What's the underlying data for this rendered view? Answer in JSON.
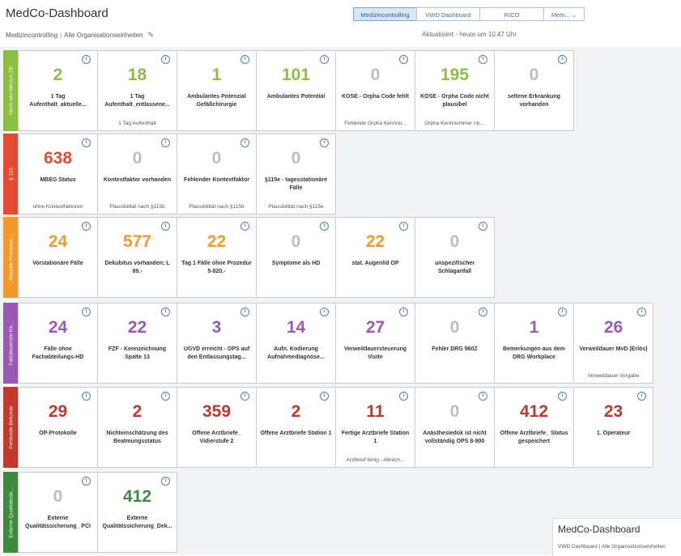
{
  "app": {
    "title": "MedCo-Dashboard",
    "breadcrumb_1": "Medizincontrolling",
    "breadcrumb_sep": "|",
    "breadcrumb_2": "Alle Organisationseinheiten",
    "updated": "Aktualisiert - heute um 10:47 Uhr"
  },
  "tabs": [
    {
      "label": "Medizincontrolling",
      "active": true
    },
    {
      "label": "VWD Dashboard",
      "active": false
    },
    {
      "label": "RICO",
      "active": false
    },
    {
      "label": "Mehr...",
      "active": false
    }
  ],
  "colors": {
    "green": "#8cbf3f",
    "red": "#e74b2f",
    "orange": "#f39a2b",
    "purple": "#9b59b6",
    "crimson": "#c0392b",
    "darkgreen": "#3d8a3d",
    "zero": "#b8bec6"
  },
  "rows": [
    {
      "band_label": "Hoch wie hierzus ZB",
      "band_color": "#8cbf3f",
      "tiles": [
        {
          "value": "2",
          "color": "#8cbf3f",
          "label": "1 Tag Aufenthalt_aktuelle...",
          "sub": ""
        },
        {
          "value": "18",
          "color": "#8cbf3f",
          "label": "1 Tag Aufenthalt_entlassene...",
          "sub": "1 Tag Aufenthalt"
        },
        {
          "value": "1",
          "color": "#8cbf3f",
          "label": "Ambulantes Potenzial Gefäßchirurgie",
          "sub": ""
        },
        {
          "value": "101",
          "color": "#8cbf3f",
          "label": "Ambulantes Potential",
          "sub": ""
        },
        {
          "value": "0",
          "color": "#b8bec6",
          "label": "KOSE - Orpha Code fehlt",
          "sub": "Fehlende Orpha Kennnu..."
        },
        {
          "value": "195",
          "color": "#8cbf3f",
          "label": "KOSE - Orpha Code nicht plausibel",
          "sub": "Orpha Kennnummer nic..."
        },
        {
          "value": "0",
          "color": "#b8bec6",
          "label": "seltene Erkrankung vorhanden",
          "sub": ""
        }
      ]
    },
    {
      "band_label": "§ 115",
      "band_color": "#e74b2f",
      "tiles": [
        {
          "value": "638",
          "color": "#e74b2f",
          "label": "MBEG Status",
          "sub": "ohne Kontextfaktoren"
        },
        {
          "value": "0",
          "color": "#b8bec6",
          "label": "Kontextfaktor vorhanden",
          "sub": "Plausibilität nach §115b"
        },
        {
          "value": "0",
          "color": "#b8bec6",
          "label": "Fehlender Kontextfaktor",
          "sub": "Plausibilität nach §115b"
        },
        {
          "value": "0",
          "color": "#b8bec6",
          "label": "§115e - tagesstationäre Fälle",
          "sub": "Plausibilität nach §115e"
        }
      ]
    },
    {
      "band_label": "Aktuelle Prozesse...",
      "band_color": "#f39a2b",
      "tiles": [
        {
          "value": "24",
          "color": "#f39a2b",
          "label": "Vorstationäre Fälle",
          "sub": ""
        },
        {
          "value": "577",
          "color": "#f39a2b",
          "label": "Dekubitus vorhanden; L 89.-",
          "sub": ""
        },
        {
          "value": "22",
          "color": "#f39a2b",
          "label": "Tag 1 Fälle ohne Prozedur 5-820.-",
          "sub": ""
        },
        {
          "value": "0",
          "color": "#b8bec6",
          "label": "Symptome als HD",
          "sub": ""
        },
        {
          "value": "22",
          "color": "#f39a2b",
          "label": "stat. Augenlid OP",
          "sub": ""
        },
        {
          "value": "0",
          "color": "#b8bec6",
          "label": "unspezifischer Schlaganfall",
          "sub": ""
        }
      ]
    },
    {
      "band_label": "Fallsteuernde Ke...",
      "band_color": "#9b59b6",
      "tiles": [
        {
          "value": "24",
          "color": "#9b59b6",
          "label": "Fälle ohne Fachabteilungs-HD",
          "sub": ""
        },
        {
          "value": "22",
          "color": "#9b59b6",
          "label": "FZF - Kennzeichnung Spalte 13",
          "sub": ""
        },
        {
          "value": "3",
          "color": "#9b59b6",
          "label": "UGVD erreicht - OPS auf den Entlassungstag...",
          "sub": ""
        },
        {
          "value": "14",
          "color": "#9b59b6",
          "label": "Aufn. Kodierung Aufnahmediagnose...",
          "sub": ""
        },
        {
          "value": "27",
          "color": "#9b59b6",
          "label": "Verweildauersteuerung Visite",
          "sub": ""
        },
        {
          "value": "0",
          "color": "#b8bec6",
          "label": "Fehler DRG 960Z",
          "sub": ""
        },
        {
          "value": "1",
          "color": "#9b59b6",
          "label": "Bemerkungen aus dem DRG Workplace",
          "sub": ""
        },
        {
          "value": "26",
          "color": "#9b59b6",
          "label": "Verweildauer MvD (Erlös)",
          "sub": "Verweildauer Vorgabe"
        }
      ]
    },
    {
      "band_label": "Fehlende Befunde",
      "band_color": "#c0392b",
      "tiles": [
        {
          "value": "29",
          "color": "#c0392b",
          "label": "OP-Protokolle",
          "sub": ""
        },
        {
          "value": "2",
          "color": "#c0392b",
          "label": "Nichteinschätzung des Beatmungsstatus",
          "sub": ""
        },
        {
          "value": "359",
          "color": "#c0392b",
          "label": "Offene Arztbriefe_ Vidierstufe 2",
          "sub": ""
        },
        {
          "value": "2",
          "color": "#c0392b",
          "label": "Offene Arztbriefe Station 1",
          "sub": ""
        },
        {
          "value": "11",
          "color": "#c0392b",
          "label": "Fertige Arztbriefe Station 1",
          "sub": "Arztbrief fertig - Abrech..."
        },
        {
          "value": "0",
          "color": "#b8bec6",
          "label": "Anästhesiedok ist nicht vollständig OPS 8-900",
          "sub": ""
        },
        {
          "value": "412",
          "color": "#c0392b",
          "label": "Offene Arztbriefe_ Status gespeichert",
          "sub": ""
        },
        {
          "value": "23",
          "color": "#c0392b",
          "label": "1. Operateur",
          "sub": ""
        }
      ]
    },
    {
      "band_label": "Externe Qualitätssic...",
      "band_color": "#3d8a3d",
      "tiles": [
        {
          "value": "0",
          "color": "#b8bec6",
          "label": "Externe Qualitätssicherung_ PCI",
          "sub": ""
        },
        {
          "value": "412",
          "color": "#3d8a3d",
          "label": "Externe Qualitätssicherung_Dek...",
          "sub": ""
        }
      ]
    }
  ],
  "popup": {
    "title": "MedCo-Dashboard",
    "sub": "VWD Dashboard | Alle Organisationseinheiten"
  }
}
